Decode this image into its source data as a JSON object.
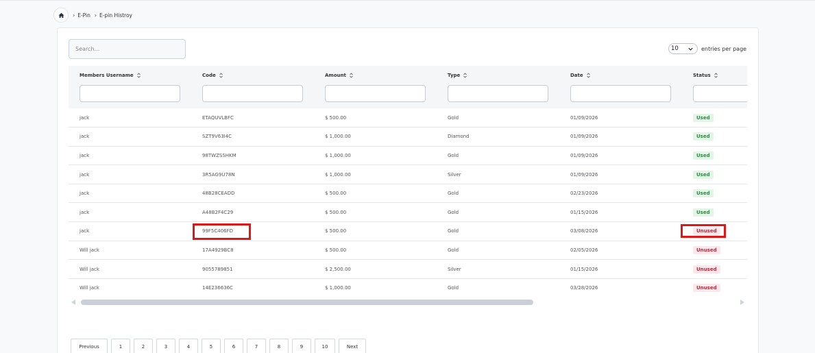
{
  "breadcrumb": {
    "items": [
      "E-Pin",
      "E-pin Histroy"
    ]
  },
  "search": {
    "placeholder": "Search..."
  },
  "pagesize": {
    "value": "10",
    "label": "entries per page"
  },
  "table": {
    "columns": [
      "Members Username",
      "Code",
      "Amount",
      "Type",
      "Date",
      "Status"
    ],
    "rows": [
      {
        "user": "jack",
        "code": "ETAQUVLBFC",
        "amount": "$ 500.00",
        "type": "Gold",
        "date": "01/09/2026",
        "status": "Used"
      },
      {
        "user": "jack",
        "code": "SZT9V63I4C",
        "amount": "$ 1,000.00",
        "type": "Diamond",
        "date": "01/09/2026",
        "status": "Used"
      },
      {
        "user": "jack",
        "code": "98TWZSSHKM",
        "amount": "$ 1,000.00",
        "type": "Gold",
        "date": "01/09/2026",
        "status": "Used"
      },
      {
        "user": "jack",
        "code": "3R5AG9U78N",
        "amount": "$ 1,000.00",
        "type": "Silver",
        "date": "01/09/2026",
        "status": "Used"
      },
      {
        "user": "jack",
        "code": "48B28CEADD",
        "amount": "$ 500.00",
        "type": "Gold",
        "date": "02/23/2026",
        "status": "Used"
      },
      {
        "user": "jack",
        "code": "A48B2F4C29",
        "amount": "$ 500.00",
        "type": "Gold",
        "date": "01/15/2026",
        "status": "Used"
      },
      {
        "user": "jack",
        "code": "99F5C406FD",
        "amount": "$ 500.00",
        "type": "Gold",
        "date": "03/08/2026",
        "status": "Unused"
      },
      {
        "user": "Will jack",
        "code": "17A4929BC8",
        "amount": "$ 500.00",
        "type": "Gold",
        "date": "02/05/2026",
        "status": "Unused"
      },
      {
        "user": "Will jack",
        "code": "9055789851",
        "amount": "$ 2,500.00",
        "type": "Silver",
        "date": "01/15/2026",
        "status": "Unused"
      },
      {
        "user": "Will jack",
        "code": "14E236636C",
        "amount": "$ 1,000.00",
        "type": "Gold",
        "date": "03/28/2026",
        "status": "Unused"
      }
    ]
  },
  "pagination": {
    "prev": "Previous",
    "pages": [
      "1",
      "2",
      "3",
      "4",
      "5",
      "6",
      "7",
      "8",
      "9",
      "10"
    ],
    "next": "Next"
  },
  "colors": {
    "used_bg": "#e3f5e7",
    "used_fg": "#2f8a44",
    "unused_bg": "#fde7ea",
    "unused_fg": "#b42b3e",
    "highlight": "#e01515"
  }
}
